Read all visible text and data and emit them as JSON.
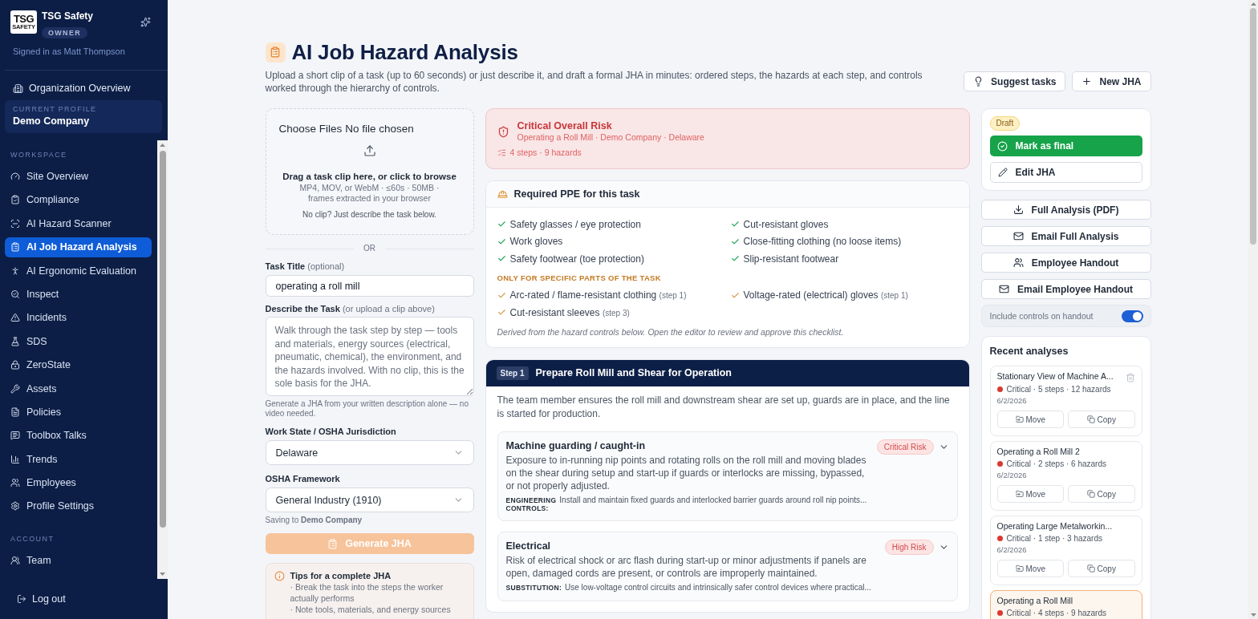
{
  "sidebar": {
    "brand": {
      "logo_text": "TSG",
      "logo_subtext": "SAFETY",
      "name": "TSG Safety",
      "role": "OWNER"
    },
    "signed_in": "Signed in as Matt Thompson",
    "org_link": "Organization Overview",
    "current_profile": {
      "label": "CURRENT PROFILE",
      "name": "Demo Company"
    },
    "sections": [
      {
        "title": "WORKSPACE",
        "items": [
          {
            "label": "Site Overview",
            "selected": false
          },
          {
            "label": "Compliance",
            "selected": false
          },
          {
            "label": "AI Hazard Scanner",
            "selected": false
          },
          {
            "label": "AI Job Hazard Analysis",
            "selected": true
          },
          {
            "label": "AI Ergonomic Evaluation",
            "selected": false
          },
          {
            "label": "Inspect",
            "selected": false
          },
          {
            "label": "Incidents",
            "selected": false
          },
          {
            "label": "SDS",
            "selected": false
          },
          {
            "label": "ZeroState",
            "selected": false
          },
          {
            "label": "Assets",
            "selected": false
          },
          {
            "label": "Policies",
            "selected": false
          },
          {
            "label": "Toolbox Talks",
            "selected": false
          },
          {
            "label": "Trends",
            "selected": false
          },
          {
            "label": "Employees",
            "selected": false
          },
          {
            "label": "Profile Settings",
            "selected": false
          }
        ]
      },
      {
        "title": "ACCOUNT",
        "items": [
          {
            "label": "Team",
            "selected": false
          }
        ]
      }
    ],
    "logout": "Log out"
  },
  "header": {
    "title": "AI Job Hazard Analysis",
    "subtitle": "Upload a short clip of a task (up to 60 seconds) or just describe it, and draft a formal JHA in minutes: ordered steps, the hazards at each step, and controls worked through the hierarchy of controls.",
    "actions": [
      "Suggest tasks",
      "New JHA"
    ]
  },
  "upload": {
    "file_button": "Choose Files",
    "file_status": "No file chosen",
    "prompt": "Drag a task clip here, or click to browse",
    "formats": "MP4, MOV, or WebM · ≤60s · 50MB · frames extracted in your browser",
    "hint": "No clip? Just describe the task below."
  },
  "divider": "OR",
  "form": {
    "task_title": {
      "label": "Task Title",
      "hint": "(optional)",
      "value": "operating a roll mill"
    },
    "description": {
      "label": "Describe the Task",
      "hint": "(or upload a clip above)",
      "placeholder": "Walk through the task step by step — tools and materials, energy sources (electrical, pneumatic, chemical), the environment, and the hazards involved. With no clip, this is the sole basis for the JHA.",
      "help": "Generate a JHA from your written description alone — no video needed."
    },
    "work_state": {
      "label": "Work State / OSHA Jurisdiction",
      "value": "Delaware"
    },
    "framework": {
      "label": "OSHA Framework",
      "value": "General Industry (1910)"
    },
    "saving_to": "Saving to **Demo Company**",
    "generate": {
      "label": "Generate JHA",
      "disabled": true
    }
  },
  "tips": {
    "title": "Tips for a complete JHA",
    "items": [
      "· Break the task into the steps the worker actually performs",
      "· Note tools, materials, and energy sources"
    ]
  },
  "risk": {
    "title": "Critical Overall Risk",
    "subtitle": "Operating a Roll Mill · Demo Company · Delaware",
    "counts": "4 steps · 9 hazards"
  },
  "ppe": {
    "title": "Required PPE for this task",
    "required": [
      "Safety glasses / eye protection",
      "Cut-resistant gloves",
      "Work gloves",
      "Close-fitting clothing (no loose items)",
      "Safety footwear (toe protection)",
      "Slip-resistant footwear"
    ],
    "conditional_title": "ONLY FOR SPECIFIC PARTS OF THE TASK",
    "conditional": [
      {
        "item": "Arc-rated / flame-resistant clothing",
        "step": "(step 1)"
      },
      {
        "item": "Voltage-rated (electrical) gloves",
        "step": "(step 1)"
      },
      {
        "item": "Cut-resistant sleeves",
        "step": "(step 3)"
      }
    ],
    "note": "Derived from the hazard controls below. Open the editor to review and approve this checklist."
  },
  "steps": [
    {
      "badge": "Step 1",
      "title": "Prepare Roll Mill and Shear for Operation",
      "description": "The team member ensures the roll mill and downstream shear are set up, guards are in place, and the line is started for production.",
      "hazards": [
        {
          "title": "Machine guarding / caught-in",
          "risk": "Critical Risk",
          "expanded": false,
          "description": "Exposure to in-running nip points and rotating rolls on the roll mill and moving blades on the shear during setup and start-up if guards or interlocks are missing, bypassed, or not properly adjusted.",
          "control_type": "ENGINEERING CONTROLS:",
          "control": "Install and maintain fixed guards and interlocked barrier guards around roll nip points..."
        },
        {
          "title": "Electrical",
          "risk": "High Risk",
          "expanded": false,
          "description": "Risk of electrical shock or arc flash during start-up or minor adjustments if panels are open, damaged cords are present, or controls are improperly maintained.",
          "control_type": "SUBSTITUTION:",
          "control": "Use low-voltage control circuits and intrinsically safer control devices where practical..."
        }
      ]
    }
  ],
  "status": {
    "badge": "Draft",
    "mark_final": "Mark as final",
    "edit": "Edit JHA"
  },
  "exports": [
    "Full Analysis (PDF)",
    "Email Full Analysis",
    "Employee Handout",
    "Email Employee Handout"
  ],
  "handout_toggle": {
    "label": "Include controls on handout",
    "on": true
  },
  "recent": {
    "title": "Recent analyses",
    "items": [
      {
        "title": "Stationary View of Machine A...",
        "color": "#d93a32",
        "meta": "Critical · 5 steps · 12 hazards",
        "date": "6/2/2026",
        "selected": false,
        "hovered": true,
        "actions": [
          {
            "kind": "move",
            "label": "Move"
          },
          {
            "kind": "copy",
            "label": "Copy"
          }
        ]
      },
      {
        "title": "Operating a Roll Mill 2",
        "color": "#d93a32",
        "meta": "Critical · 2 steps · 6 hazards",
        "date": "6/2/2026",
        "selected": false,
        "hovered": false,
        "actions": [
          {
            "kind": "move",
            "label": "Move"
          },
          {
            "kind": "copy",
            "label": "Copy"
          }
        ]
      },
      {
        "title": "Operating Large Metalworkin...",
        "color": "#d93a32",
        "meta": "Critical · 1 step · 3 hazards",
        "date": "6/2/2026",
        "selected": false,
        "hovered": false,
        "actions": [
          {
            "kind": "move",
            "label": "Move"
          },
          {
            "kind": "copy",
            "label": "Copy"
          }
        ]
      },
      {
        "title": "Operating a Roll Mill",
        "color": "#d93a32",
        "meta": "Critical · 4 steps · 9 hazards",
        "selected": true,
        "hovered": false
      }
    ]
  }
}
